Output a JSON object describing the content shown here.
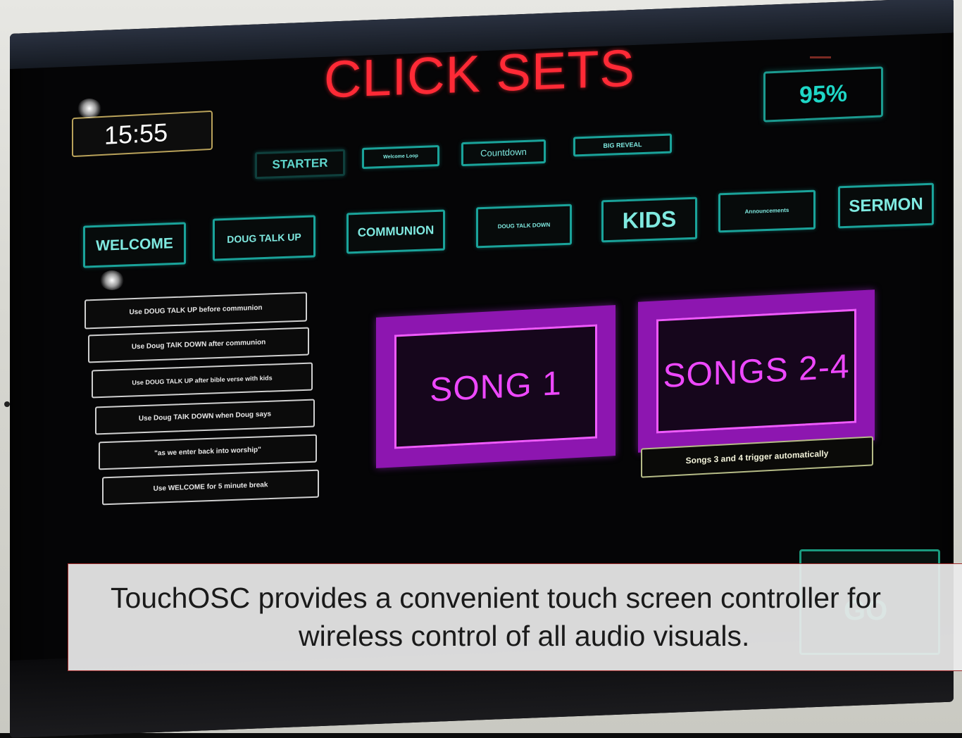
{
  "app": {
    "title": "CLICK SETS",
    "clock": "15:55",
    "battery": "95%"
  },
  "toolbar_row": [
    {
      "label": "STARTER"
    },
    {
      "label": "Welcome Loop"
    },
    {
      "label": "Countdown"
    },
    {
      "label": "BIG REVEAL"
    }
  ],
  "cue_row": [
    {
      "label": "WELCOME"
    },
    {
      "label": "DOUG TALK UP"
    },
    {
      "label": "COMMUNION"
    },
    {
      "label": "DOUG TALK DOWN"
    },
    {
      "label": "KIDS"
    },
    {
      "label": "Announcements"
    },
    {
      "label": "SERMON"
    }
  ],
  "notes": [
    "Use DOUG TALK UP before communion",
    "Use Doug TAlK DOWN after communion",
    "Use DOUG TALK UP after bible verse with kids",
    "Use Doug TAlK DOWN when Doug says",
    "\"as we enter back into worship\"",
    "Use WELCOME for 5 minute break"
  ],
  "songs": {
    "song1": "SONG 1",
    "songs24": "SONGS 2-4",
    "songs24_note": "Songs 3 and 4 trigger automatically"
  },
  "go_button": {
    "label": "GO"
  },
  "caption": {
    "line1": "TouchOSC provides a convenient touch screen controller for",
    "line2": "wireless control of all audio visuals."
  },
  "colors": {
    "title_red": "#ff2a36",
    "teal": "#1aa39a",
    "magenta": "#8d16b0"
  }
}
